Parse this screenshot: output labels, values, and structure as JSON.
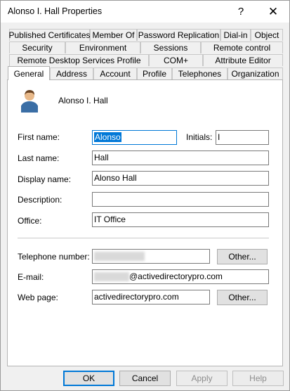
{
  "window": {
    "title": "Alonso I. Hall Properties",
    "help_glyph": "?",
    "close_glyph": "✕"
  },
  "tabs": {
    "row1": [
      "Published Certificates",
      "Member Of",
      "Password Replication",
      "Dial-in",
      "Object"
    ],
    "row2": [
      "Security",
      "Environment",
      "Sessions",
      "Remote control"
    ],
    "row3": [
      "Remote Desktop Services Profile",
      "COM+",
      "Attribute Editor"
    ],
    "row4": [
      "General",
      "Address",
      "Account",
      "Profile",
      "Telephones",
      "Organization"
    ],
    "active": "General"
  },
  "general": {
    "user_display": "Alonso I. Hall",
    "labels": {
      "first_name": "First name:",
      "initials": "Initials:",
      "last_name": "Last name:",
      "display_name": "Display name:",
      "description": "Description:",
      "office": "Office:",
      "telephone": "Telephone number:",
      "email": "E-mail:",
      "web_page": "Web page:"
    },
    "values": {
      "first_name": "Alonso",
      "initials": "I",
      "last_name": "Hall",
      "display_name": "Alonso Hall",
      "description": "",
      "office": "IT Office",
      "telephone": "",
      "email_visible_part": "@activedirectorypro.com",
      "web_page": "activedirectorypro.com"
    },
    "other_button": "Other..."
  },
  "footer": {
    "ok": "OK",
    "cancel": "Cancel",
    "apply": "Apply",
    "help": "Help"
  }
}
